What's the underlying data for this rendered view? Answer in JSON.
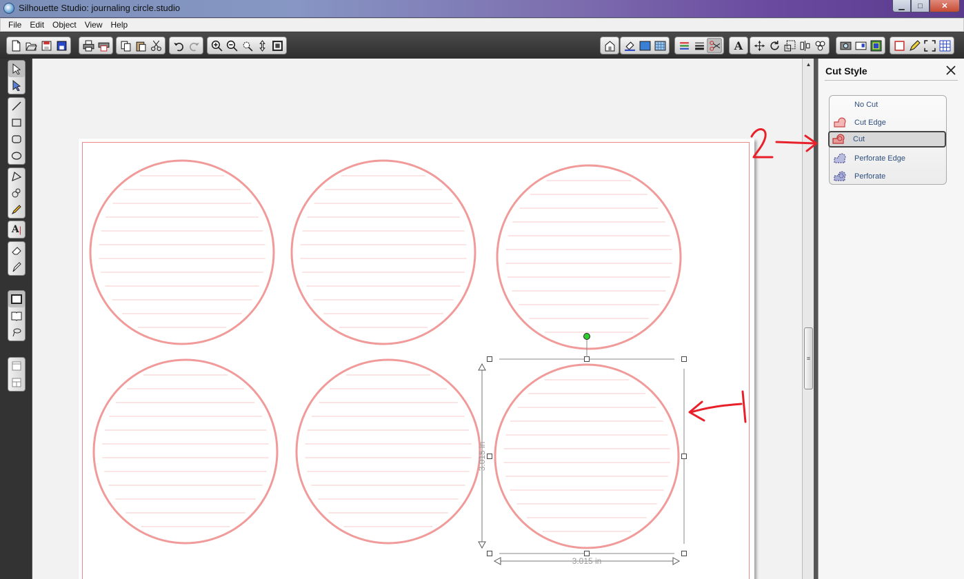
{
  "window": {
    "title": "Silhouette Studio: journaling circle.studio",
    "controls": {
      "minimize": "▁",
      "maximize": "□",
      "close": "✕"
    }
  },
  "menu": [
    "File",
    "Edit",
    "Object",
    "View",
    "Help"
  ],
  "toolbar": {
    "left_groups": [
      [
        "new-document-icon",
        "open-folder-icon",
        "save-icon",
        "save-to-library-icon"
      ],
      [
        "print-icon",
        "print-cut-icon"
      ],
      [
        "copy-icon",
        "paste-icon",
        "cut-scissors-icon"
      ],
      [
        "undo-icon",
        "redo-icon"
      ],
      [
        "zoom-in-icon",
        "zoom-out-icon",
        "zoom-select-icon",
        "pan-icon",
        "fit-page-icon"
      ]
    ],
    "right_groups": [
      [
        "store-icon"
      ],
      [
        "fill-color-icon",
        "fill-gradient-icon",
        "fill-pattern-icon"
      ],
      [
        "line-color-icon",
        "line-style-icon",
        "cut-style-icon"
      ],
      [
        "text-style-icon"
      ],
      [
        "transform-icon",
        "rotate-icon",
        "scale-icon",
        "align-icon",
        "replicate-icon"
      ],
      [
        "trace-icon",
        "offset-icon",
        "modify-icon"
      ],
      [
        "page-setup-icon",
        "sketch-icon",
        "fullscreen-icon",
        "grid-icon"
      ]
    ],
    "active": "cut-style-icon"
  },
  "left_tools": [
    [
      "select-icon",
      "point-edit-icon"
    ],
    [
      "line-icon",
      "rectangle-icon",
      "rounded-rectangle-icon",
      "ellipse-icon"
    ],
    [
      "polygon-icon",
      "curve-icon",
      "freehand-icon"
    ],
    [
      "text-icon"
    ],
    [
      "eraser-icon",
      "knife-icon"
    ],
    [
      "draw-mode-icon",
      "library-icon",
      "lasso-icon"
    ],
    [
      "view-single-icon",
      "view-split-icon"
    ]
  ],
  "canvas": {
    "selection_width": "3.015 in",
    "selection_height": "3.015 in",
    "circle_color": "#f19a9a",
    "line_color": "#f6c9c9"
  },
  "cut_style_panel": {
    "title": "Cut Style",
    "options": [
      {
        "label": "No Cut",
        "icon": "no-cut-icon"
      },
      {
        "label": "Cut Edge",
        "icon": "cut-edge-icon"
      },
      {
        "label": "Cut",
        "icon": "cut-icon"
      },
      {
        "label": "Perforate Edge",
        "icon": "perforate-edge-icon"
      },
      {
        "label": "Perforate",
        "icon": "perforate-icon"
      }
    ],
    "selected": "Cut"
  },
  "annotations": {
    "label_1": "1",
    "label_2": "2",
    "color": "#e8202a"
  }
}
